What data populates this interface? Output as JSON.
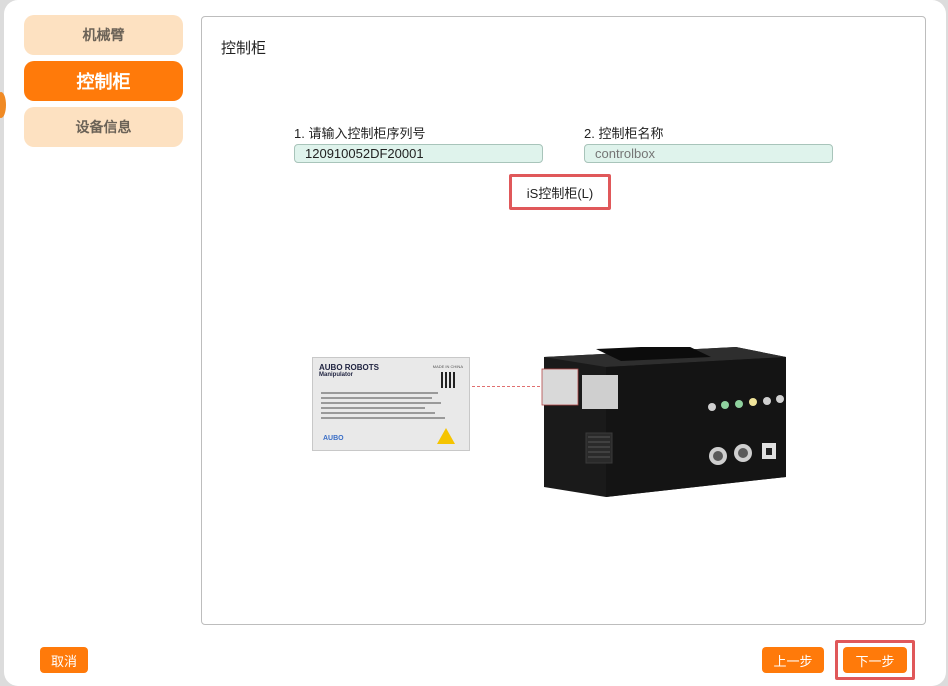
{
  "sidebar": {
    "items": [
      {
        "label": "机械臂",
        "active": false
      },
      {
        "label": "控制柜",
        "active": true
      },
      {
        "label": "设备信息",
        "active": false
      }
    ]
  },
  "panel": {
    "title": "控制柜",
    "serial_field": {
      "label": "1. 请输入控制柜序列号",
      "value": "120910052DF20001"
    },
    "name_field": {
      "label": "2. 控制柜名称",
      "placeholder": "controlbox"
    },
    "model_label": "iS控制柜(L)",
    "nameplate": {
      "brand": "AUBO ROBOTS",
      "product": "Manipulator",
      "origin": "MADE IN CHINA",
      "logo_text": "AUBO"
    }
  },
  "footer": {
    "cancel_label": "取消",
    "prev_label": "上一步",
    "next_label": "下一步"
  },
  "colors": {
    "accent": "#ff7a0a",
    "accent_light": "#fde1c1",
    "highlight": "#e0585a",
    "input_bg": "#dff3ec"
  }
}
